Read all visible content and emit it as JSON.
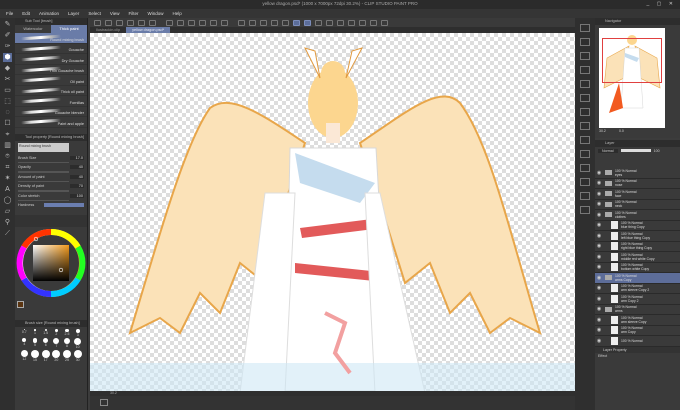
{
  "window": {
    "title": "yellow dragon.psd* (1000 x 7000px 72dpi 30.2%) - CLIP STUDIO PAINT PRO",
    "controls": "_ ▢ ✕"
  },
  "menu": [
    "File",
    "Edit",
    "Animation",
    "Layer",
    "Select",
    "View",
    "Filter",
    "Window",
    "Help"
  ],
  "tabs": [
    "Ilustración.clip",
    "yellow dragon.psd*"
  ],
  "subtool": {
    "header": "Sub Tool [brush]",
    "tabs": [
      "Watercolor",
      "Thick paint"
    ],
    "brushes": [
      "Round mixing brush",
      "Gouache",
      "Dry Gouache",
      "Thin Gouache brush",
      "Oil paint",
      "Thick oil paint",
      "Fornillas",
      "Gouache blender",
      "Paint and apple"
    ]
  },
  "tool_property": {
    "header": "Tool property [Round mixing brush]",
    "preset": "Round mixing brush",
    "props": [
      {
        "label": "Brush Size",
        "value": "17.0"
      },
      {
        "label": "Opacity",
        "value": "40"
      },
      {
        "label": "Amount of paint",
        "value": "40"
      },
      {
        "label": "Density of paint",
        "value": "70"
      },
      {
        "label": "Color stretch",
        "value": "100"
      }
    ],
    "hardness_label": "Hardness"
  },
  "brush_size": {
    "header": "Brush size [Round mixing brush]",
    "sizes": [
      "0.7",
      "1",
      "1.5",
      "2",
      "2.5",
      "3",
      "4",
      "5",
      "6",
      "7",
      "8",
      "10",
      "12",
      "15",
      "17",
      "20",
      "25",
      "30"
    ]
  },
  "color": {
    "main": "#5a3410",
    "wheel_marker": "#e8b87a"
  },
  "navigator": {
    "header": "Navigator",
    "zoom": "30.2",
    "angle": "0.0"
  },
  "layers": {
    "header": "Layer",
    "blend": "Normal",
    "opacity": "100",
    "items": [
      {
        "type": "folder",
        "mode": "100 % Normal",
        "name": "eyes"
      },
      {
        "type": "folder",
        "mode": "100 % Normal",
        "name": "nose"
      },
      {
        "type": "folder",
        "mode": "100 % Normal",
        "name": "face"
      },
      {
        "type": "folder",
        "mode": "100 % Normal",
        "name": "neck"
      },
      {
        "type": "folder",
        "mode": "100 % Normal",
        "name": "clothes"
      },
      {
        "type": "layer",
        "mode": "100 % Normal",
        "name": "blue thing Copy"
      },
      {
        "type": "layer",
        "mode": "100 % Normal",
        "name": "left blue thing Copy"
      },
      {
        "type": "layer",
        "mode": "100 % Normal",
        "name": "right blue thing Copy"
      },
      {
        "type": "layer",
        "mode": "100 % Normal",
        "name": "middle red white Copy"
      },
      {
        "type": "layer",
        "mode": "100 % Normal",
        "name": "bottom white Copy"
      },
      {
        "type": "folder",
        "mode": "100 % Normal",
        "name": "arms Copy",
        "active": true
      },
      {
        "type": "layer",
        "mode": "100 % Normal",
        "name": "arm sleeve Copy 2"
      },
      {
        "type": "layer",
        "mode": "100 % Normal",
        "name": "arm Copy 2"
      },
      {
        "type": "folder",
        "mode": "100 % Normal",
        "name": "arms"
      },
      {
        "type": "layer",
        "mode": "100 % Normal",
        "name": "arm sleeve Copy"
      },
      {
        "type": "layer",
        "mode": "100 % Normal",
        "name": "arm Copy"
      },
      {
        "type": "layer",
        "mode": "100 % Normal",
        "name": ""
      }
    ],
    "footer": "Layer Property",
    "effect_label": "Effect"
  }
}
